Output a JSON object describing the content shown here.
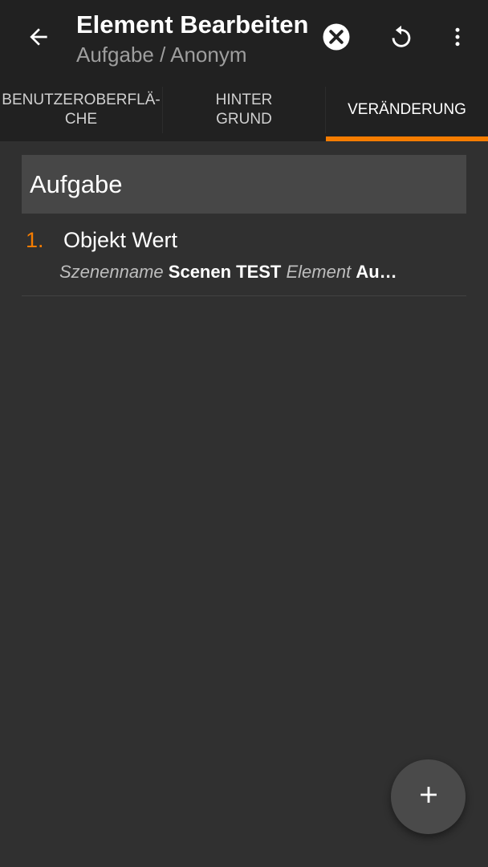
{
  "header": {
    "title": "Element Bearbeiten",
    "subtitle": "Aufgabe / Anonym",
    "icons": {
      "back": "arrow-back-icon",
      "close": "close-circle-icon",
      "revert": "undo-icon",
      "menu": "more-vert-icon"
    }
  },
  "tabs": [
    {
      "label": "Benutzeroberflä-\nche",
      "active": false
    },
    {
      "label": "Hinter\ngrund",
      "active": false
    },
    {
      "label": "Veränderung",
      "active": true
    }
  ],
  "section": {
    "title": "Aufgabe"
  },
  "actions": [
    {
      "number": "1.",
      "name": "Objekt Wert",
      "params": [
        {
          "key": "Szenenname",
          "value": "Scenen TEST"
        },
        {
          "key": "Element",
          "value": "Au…"
        }
      ]
    }
  ],
  "fab": {
    "icon": "plus-icon"
  },
  "colors": {
    "accent": "#f57c00",
    "toolbar": "#212121",
    "background": "#303030",
    "section_header": "#474747"
  }
}
